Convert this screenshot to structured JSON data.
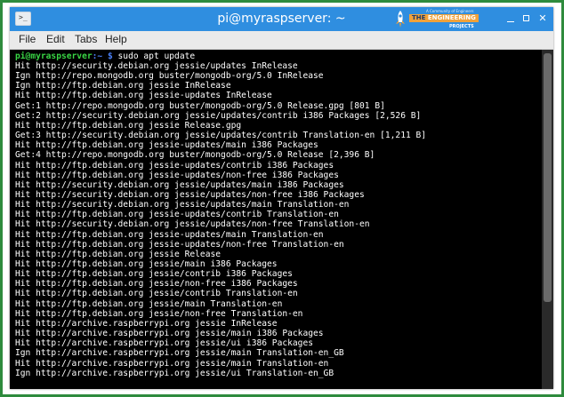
{
  "window": {
    "title": "pi@myraspserver: ~",
    "controls": {
      "minimize": "",
      "maximize": "",
      "close": "✕"
    }
  },
  "logo": {
    "tagline": "A Community of Engineers",
    "main_prefix": "THE",
    "main_word": "ENGINEERING",
    "sub": "PROJECTS"
  },
  "menu": {
    "items": [
      "File",
      "Edit",
      "Tabs",
      "Help"
    ]
  },
  "terminal": {
    "prompt_user": "pi@myraspserver",
    "prompt_path": ":~ $",
    "command": " sudo apt update",
    "lines": [
      "Hit http://security.debian.org jessie/updates InRelease",
      "Ign http://repo.mongodb.org buster/mongodb-org/5.0 InRelease",
      "Ign http://ftp.debian.org jessie InRelease",
      "Hit http://ftp.debian.org jessie-updates InRelease",
      "Get:1 http://repo.mongodb.org buster/mongodb-org/5.0 Release.gpg [801 B]",
      "Get:2 http://security.debian.org jessie/updates/contrib i386 Packages [2,526 B]",
      "Hit http://ftp.debian.org jessie Release.gpg",
      "Get:3 http://security.debian.org jessie/updates/contrib Translation-en [1,211 B]",
      "Hit http://ftp.debian.org jessie-updates/main i386 Packages",
      "Get:4 http://repo.mongodb.org buster/mongodb-org/5.0 Release [2,396 B]",
      "Hit http://ftp.debian.org jessie-updates/contrib i386 Packages",
      "Hit http://ftp.debian.org jessie-updates/non-free i386 Packages",
      "Hit http://security.debian.org jessie/updates/main i386 Packages",
      "Hit http://security.debian.org jessie/updates/non-free i386 Packages",
      "Hit http://security.debian.org jessie/updates/main Translation-en",
      "Hit http://ftp.debian.org jessie-updates/contrib Translation-en",
      "Hit http://security.debian.org jessie/updates/non-free Translation-en",
      "Hit http://ftp.debian.org jessie-updates/main Translation-en",
      "Hit http://ftp.debian.org jessie-updates/non-free Translation-en",
      "Hit http://ftp.debian.org jessie Release",
      "Hit http://ftp.debian.org jessie/main i386 Packages",
      "Hit http://ftp.debian.org jessie/contrib i386 Packages",
      "Hit http://ftp.debian.org jessie/non-free i386 Packages",
      "Hit http://ftp.debian.org jessie/contrib Translation-en",
      "Hit http://ftp.debian.org jessie/main Translation-en",
      "Hit http://ftp.debian.org jessie/non-free Translation-en",
      "Hit http://archive.raspberrypi.org jessie InRelease",
      "Hit http://archive.raspberrypi.org jessie/main i386 Packages",
      "Hit http://archive.raspberrypi.org jessie/ui i386 Packages",
      "Ign http://archive.raspberrypi.org jessie/main Translation-en_GB",
      "Hit http://archive.raspberrypi.org jessie/main Translation-en",
      "Ign http://archive.raspberrypi.org jessie/ui Translation-en_GB"
    ]
  },
  "colors": {
    "frame_border": "#2e8b3d",
    "titlebar": "#2f8ee0",
    "prompt_user": "#39d645",
    "prompt_path": "#4a7ff5",
    "terminal_bg": "#000000",
    "terminal_fg": "#ffffff"
  },
  "icons": {
    "app": "terminal-icon",
    "logo": "rocket-icon"
  }
}
